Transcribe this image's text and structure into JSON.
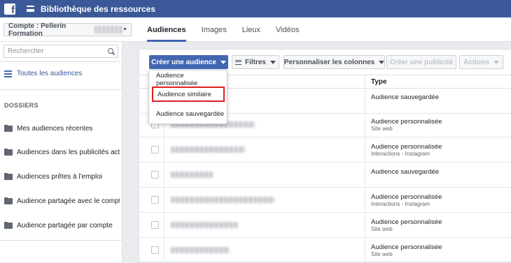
{
  "topbar": {
    "title": "Bibliothèque des ressources",
    "logo_icon": "facebook-logo-icon",
    "menu_icon": "hamburger-icon"
  },
  "account": {
    "label": "Compte : Pellerin Formation",
    "caret_icon": "chevron-down-icon"
  },
  "tabs": [
    {
      "label": "Audiences",
      "active": true
    },
    {
      "label": "Images",
      "active": false
    },
    {
      "label": "Lieux",
      "active": false
    },
    {
      "label": "Vidéos",
      "active": false
    }
  ],
  "sidebar": {
    "search_placeholder": "Rechercher",
    "all_audiences": "Toutes les audiences",
    "section_title": "DOSSIERS",
    "folders": [
      "Mes audiences récentes",
      "Audiences dans les publicités acti...",
      "Audiences prêtes à l'emploi",
      "Audience partagée avec le compte",
      "Audience partagée par compte"
    ]
  },
  "toolbar": {
    "create_label": "Créer une audience",
    "filters_label": "Filtres",
    "customize_label": "Personnaliser les colonnes",
    "create_ad_label": "Créer une publicité",
    "actions_label": "Actions"
  },
  "create_menu": {
    "items": [
      "Audience personnalisée",
      "Audience similaire",
      "Audience sauvegardée"
    ],
    "highlighted_index": 1,
    "highlight_color": "#e02020"
  },
  "table": {
    "type_header": "Type",
    "rows": [
      {
        "type": "Audience sauvegardée",
        "sub": ""
      },
      {
        "type": "Audience personnalisée",
        "sub": "Site web"
      },
      {
        "type": "Audience personnalisée",
        "sub": "Interactions - Instagram"
      },
      {
        "type": "Audience sauvegardée",
        "sub": ""
      },
      {
        "type": "Audience personnalisée",
        "sub": "Interactions - Instagram"
      },
      {
        "type": "Audience personnalisée",
        "sub": "Site web"
      },
      {
        "type": "Audience personnalisée",
        "sub": "Site web"
      }
    ]
  },
  "colors": {
    "brand": "#3b5998",
    "primary_button": "#4267b2",
    "link": "#365899"
  }
}
